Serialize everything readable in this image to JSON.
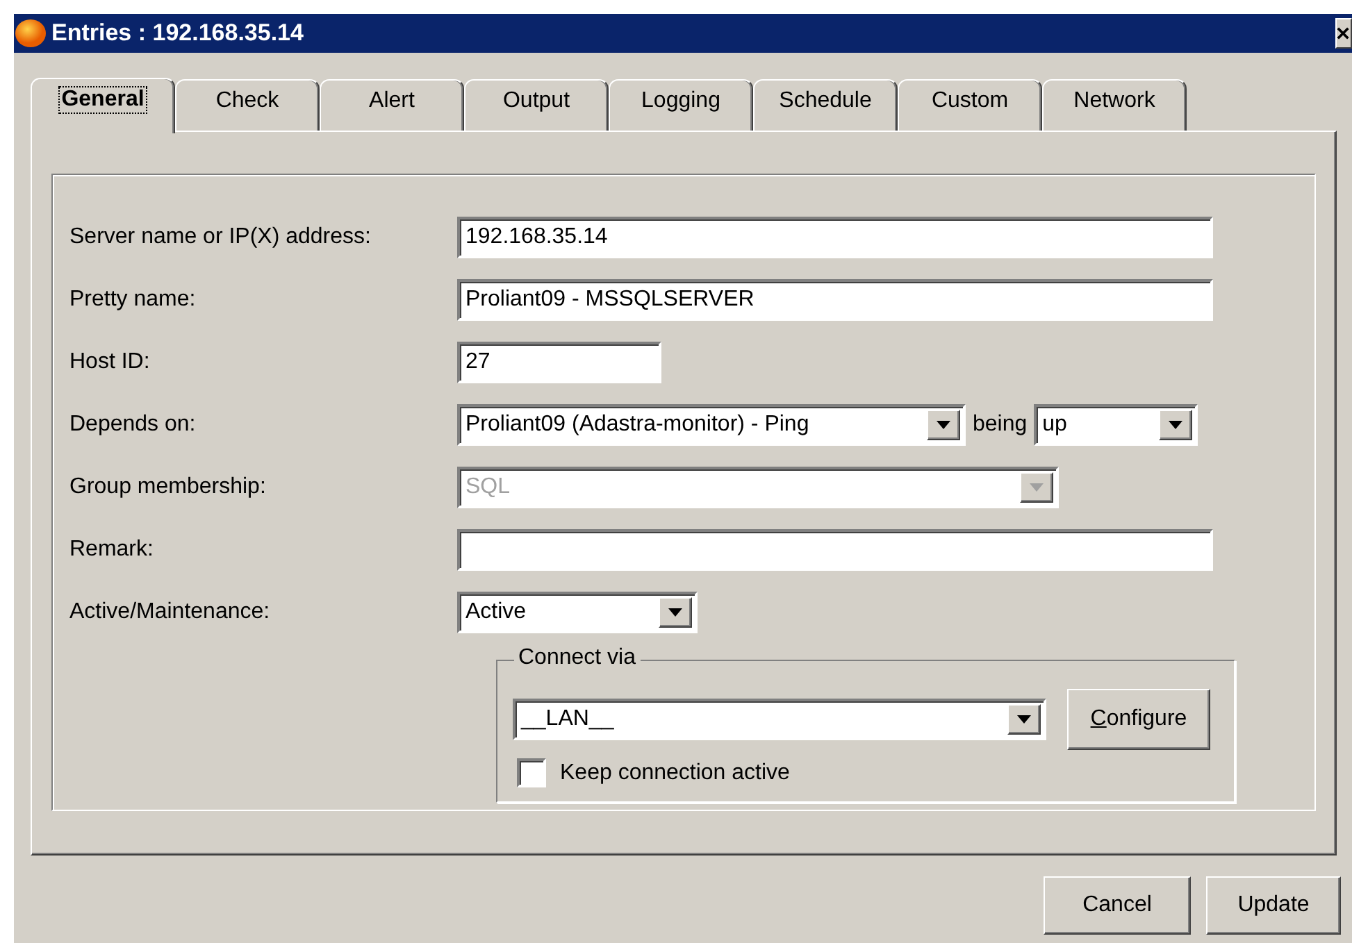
{
  "window": {
    "title": "Entries : 192.168.35.14"
  },
  "tabs": [
    {
      "label": "General",
      "selected": true
    },
    {
      "label": "Check",
      "selected": false
    },
    {
      "label": "Alert",
      "selected": false
    },
    {
      "label": "Output",
      "selected": false
    },
    {
      "label": "Logging",
      "selected": false
    },
    {
      "label": "Schedule",
      "selected": false
    },
    {
      "label": "Custom",
      "selected": false
    },
    {
      "label": "Network",
      "selected": false
    }
  ],
  "fields": [
    {
      "kind": "text",
      "label": "Server name or IP(X) address:",
      "value": "192.168.35.14"
    },
    {
      "kind": "text",
      "label": "Pretty name:",
      "value": "Proliant09 - MSSQLSERVER"
    },
    {
      "kind": "id",
      "label": "Host ID:",
      "value": "27"
    },
    {
      "kind": "dependency",
      "label": "Depends on:",
      "value": "Proliant09 (Adastra-monitor) - Ping",
      "state_label": "being",
      "state_value": "up"
    },
    {
      "kind": "group",
      "label": "Group membership:",
      "value": "SQL",
      "disabled": true
    },
    {
      "kind": "text",
      "label": "Remark:"
    },
    {
      "kind": "state",
      "label": "Active/Maintenance:",
      "value": "Active"
    }
  ],
  "connect_via": {
    "title": "Connect via",
    "value": "__LAN__",
    "button": {
      "label": "Configure",
      "first_letter_underlined": true
    },
    "checkbox": {
      "label": "Keep connection active",
      "checked": false
    }
  },
  "buttons": [
    {
      "label": "Cancel"
    },
    {
      "label": "Update"
    }
  ]
}
